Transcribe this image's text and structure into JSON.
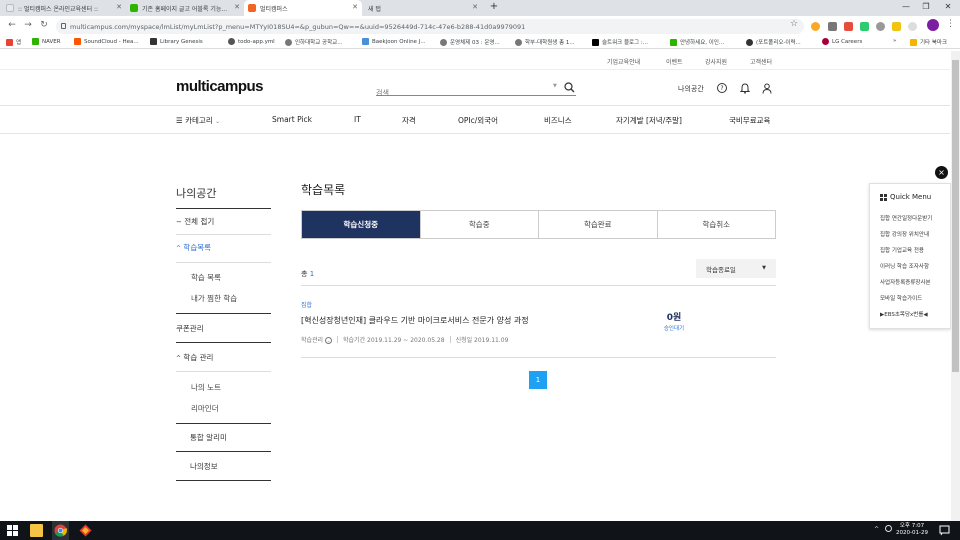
{
  "browser": {
    "tabs": [
      {
        "title": ":: 멀티캠퍼스 온라인교육센터 ::",
        "favicon_color": "#e8eaed"
      },
      {
        "title": "기존 홈페이지 글고 어블록 기능...",
        "favicon_color": "#2db400"
      },
      {
        "title": "멀티캠퍼스",
        "favicon_color": "#f26522"
      },
      {
        "title": "새 탭",
        "favicon_color": ""
      }
    ],
    "new_tab_symbol": "+",
    "url": "multicampus.com/myspace/lmList/myLmList?p_menu=MTYyI018SU4=&p_gubun=Qw==&uuid=9526449d-714c-47e6-b288-41d0a9979091",
    "bookmarks": [
      {
        "label": "앱",
        "color": "#ea4335"
      },
      {
        "label": "NAVER",
        "color": "#2db400"
      },
      {
        "label": "SoundCloud - Hea...",
        "color": "#ff5500"
      },
      {
        "label": "Library Genesis",
        "color": "#333333"
      },
      {
        "label": "todo-app.yml",
        "color": "#555555"
      },
      {
        "label": "인하대학교 공학교...",
        "color": "#555555"
      },
      {
        "label": "Baekjoon Online J...",
        "color": "#4a90d9"
      },
      {
        "label": "운영체제 03 : 운영...",
        "color": "#555555"
      },
      {
        "label": "학부-대학원생 총 1...",
        "color": "#555555"
      },
      {
        "label": "슬트워크 블로그 :...",
        "color": "#000000"
      },
      {
        "label": "안녕하세요, 이인...",
        "color": "#2db400"
      },
      {
        "label": "(포트폴리오-이력...",
        "color": "#333333"
      },
      {
        "label": "LG Careers",
        "color": "#a50034"
      },
      {
        "label": "»",
        "color": ""
      },
      {
        "label": "기타 북마크",
        "color": "#f4b400"
      }
    ]
  },
  "util_links": [
    "기업교육안내",
    "이벤트",
    "강사지원",
    "고객센터"
  ],
  "header": {
    "logo": "multicampus",
    "search_placeholder": "검색",
    "my_space": "나의공간"
  },
  "gnb": {
    "category": "카테고리",
    "items": [
      "Smart Pick",
      "IT",
      "자격",
      "OPIc/외국어",
      "비즈니스",
      "자기계발 [저녁/주말]",
      "국비무료교육"
    ]
  },
  "lnb": {
    "title": "나의공간",
    "collapse_all": "전체 접기",
    "learning_list": "학습목록",
    "learning_list_sub": [
      "학습 목록",
      "내가 찜한 학습"
    ],
    "coupon": "쿠폰관리",
    "learning_manage": "학습 관리",
    "learning_manage_sub": [
      "나의 노트",
      "리마인더"
    ],
    "notice": "통합 알리미",
    "my_info": "나의정보"
  },
  "main": {
    "title": "학습목록",
    "tabs": [
      "학습신청중",
      "학습중",
      "학습완료",
      "학습취소"
    ],
    "total_label": "총",
    "total_count": "1",
    "sort_label": "학습종료일",
    "course": {
      "category": "집합",
      "title": "[혁신성장청년인재] 클라우드 기반 마이크로서비스 전문가 양성 과정",
      "manage_label": "학습관리",
      "period": "학습기간  2019.11.29 ~ 2020.05.28",
      "applied": "신청일  2019.11.09",
      "price": "0원",
      "status": "승인대기"
    },
    "page": "1"
  },
  "quick_menu": {
    "close": "×",
    "title": "Quick Menu",
    "items": [
      "집합 연간일정다운받기",
      "집합 강의장 위치안내",
      "집합 기업교육 전용",
      "이러닝 학습 조자사항",
      "사업자등록증류장사본",
      "모바일 학습가이드",
      "▶EBS초목당x번를◀"
    ]
  },
  "taskbar": {
    "time": "오후 7:07",
    "date": "2020-01-29"
  }
}
